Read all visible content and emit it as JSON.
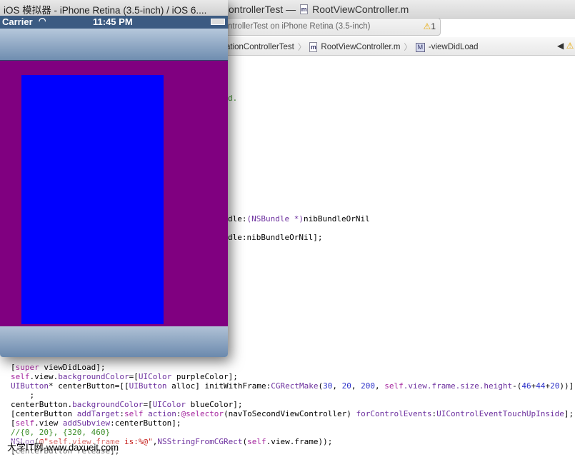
{
  "xcode": {
    "title_project": "ontrollerTest —",
    "title_file": "RootViewController.m",
    "activity": "ntrollerTest on iPhone Retina (3.5-inch)",
    "warning_count": "1",
    "jump": [
      "ationControllerTest",
      "RootViewController.m",
      "-viewDidLoad"
    ],
    "file_badge": "m",
    "method_badge": "M"
  },
  "code": {
    "partial": [
      {
        "text": "d.",
        "cls": "c"
      },
      {
        "segs": [
          [
            "dle:",
            "p"
          ],
          [
            "(NSBundle *)",
            "cl"
          ],
          [
            "nibBundleOrNil",
            "p"
          ]
        ]
      },
      {
        "segs": [
          [
            "dle:nibBundleOrNil];",
            "p"
          ]
        ]
      }
    ],
    "lines": [
      [
        [
          "[",
          "p"
        ],
        [
          "super",
          "k"
        ],
        [
          " viewDidLoad];",
          "p"
        ]
      ],
      [
        [
          "self",
          "k"
        ],
        [
          ".view.",
          "p"
        ],
        [
          "backgroundColor",
          "cl"
        ],
        [
          "=[",
          "p"
        ],
        [
          "UIColor",
          "cl"
        ],
        [
          " purpleColor];",
          "p"
        ]
      ],
      [
        [
          "UIButton",
          "cl"
        ],
        [
          "* centerButton=[[",
          "p"
        ],
        [
          "UIButton",
          "cl"
        ],
        [
          " alloc] initWithFrame:",
          "p"
        ],
        [
          "CGRectMake",
          "cl"
        ],
        [
          "(",
          "p"
        ],
        [
          "30",
          "n"
        ],
        [
          ", ",
          "p"
        ],
        [
          "20",
          "n"
        ],
        [
          ", ",
          "p"
        ],
        [
          "200",
          "n"
        ],
        [
          ", ",
          "p"
        ],
        [
          "self",
          "k"
        ],
        [
          ".view.frame.size.height",
          "cl"
        ],
        [
          "-(",
          "p"
        ],
        [
          "46",
          "n"
        ],
        [
          "+",
          "p"
        ],
        [
          "44",
          "n"
        ],
        [
          "+",
          "p"
        ],
        [
          "20",
          "n"
        ],
        [
          "))]",
          "p"
        ]
      ],
      [
        [
          "    ;",
          "p"
        ]
      ],
      [
        [
          "centerButton.",
          "p"
        ],
        [
          "backgroundColor",
          "cl"
        ],
        [
          "=[",
          "p"
        ],
        [
          "UIColor",
          "cl"
        ],
        [
          " blueColor];",
          "p"
        ]
      ],
      [
        [
          "[centerButton ",
          "p"
        ],
        [
          "addTarget",
          "cl"
        ],
        [
          ":",
          "p"
        ],
        [
          "self",
          "k"
        ],
        [
          " ",
          "p"
        ],
        [
          "action",
          "cl"
        ],
        [
          ":",
          "p"
        ],
        [
          "@selector",
          "k"
        ],
        [
          "(navToSecondViewController) ",
          "p"
        ],
        [
          "forControlEvents",
          "cl"
        ],
        [
          ":",
          "p"
        ],
        [
          "UIControlEventTouchUpInside",
          "cl"
        ],
        [
          "];",
          "p"
        ]
      ],
      [
        [
          "[",
          "p"
        ],
        [
          "self",
          "k"
        ],
        [
          ".view ",
          "p"
        ],
        [
          "addSubview",
          "cl"
        ],
        [
          ":centerButton];",
          "p"
        ]
      ],
      [
        [
          "//{0, 20}, {320, 460}",
          "c"
        ]
      ],
      [
        [
          "NSLog",
          "cl"
        ],
        [
          "(",
          "p"
        ],
        [
          "@\"self.view.frame is:%@\"",
          "s"
        ],
        [
          ",",
          "p"
        ],
        [
          "NSStringFromCGRect",
          "cl"
        ],
        [
          "(",
          "p"
        ],
        [
          "self",
          "k"
        ],
        [
          ".view.frame));",
          "p"
        ]
      ],
      [
        [
          "[centerButton release];",
          "p"
        ]
      ]
    ]
  },
  "simulator": {
    "title": "iOS 模拟器 - iPhone Retina (3.5-inch) / iOS 6....",
    "carrier": "Carrier",
    "time": "11:45 PM",
    "view_color": "#800080",
    "button_color": "#0000ff"
  },
  "watermark": "大学IT网-www.daxueit.com"
}
